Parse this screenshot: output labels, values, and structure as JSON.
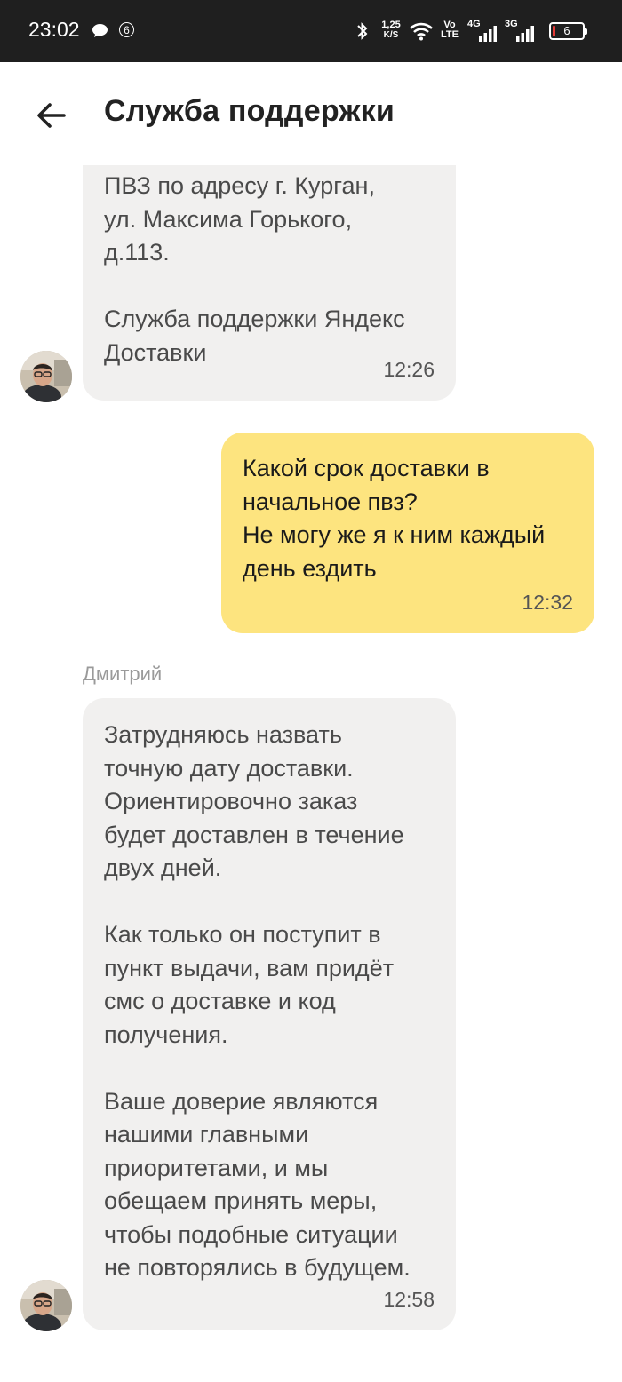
{
  "status_bar": {
    "time": "23:02",
    "notification_count": "6",
    "net_speed_top": "1,25",
    "net_speed_bottom": "K/S",
    "volte_top": "Vo",
    "volte_bottom": "LTE",
    "net1": "4G",
    "net2": "3G",
    "battery": "6",
    "battery_level_percent": 6,
    "battery_low_color": "#e53935",
    "icons": [
      "chat-bubble-icon",
      "bluetooth-icon",
      "wifi-icon",
      "signal-icon",
      "battery-icon"
    ]
  },
  "header": {
    "title": "Служба поддержки",
    "back_icon": "arrow-left-icon"
  },
  "messages": [
    {
      "direction": "incoming",
      "text": "ПВЗ по адресу г. Курган,\nул. Максима Горького,\nд.113.\n\nСлужба поддержки Яндекс\nДоставки",
      "time": "12:26"
    },
    {
      "direction": "outgoing",
      "text": "Какой срок доставки в\nначальное пвз?\nНе могу же я к ним каждый\nдень ездить",
      "time": "12:32"
    },
    {
      "direction": "incoming",
      "sender": "Дмитрий",
      "text": "Затрудняюсь назвать\nточную дату доставки.\nОриентировочно заказ\nбудет доставлен в течение\nдвух дней.\n\nКак только он поступит в\nпункт выдачи, вам придёт\nсмс о доставке и код\nполучения.\n\nВаше доверие являются\nнашими главными\nприоритетами, и мы\nобещаем принять меры,\nчтобы подобные ситуации\nне повторялись в будущем.",
      "time": "12:58"
    }
  ],
  "colors": {
    "incoming_bubble": "#f1f0ef",
    "outgoing_bubble": "#fde47f",
    "status_bar": "#1f1f1f"
  }
}
